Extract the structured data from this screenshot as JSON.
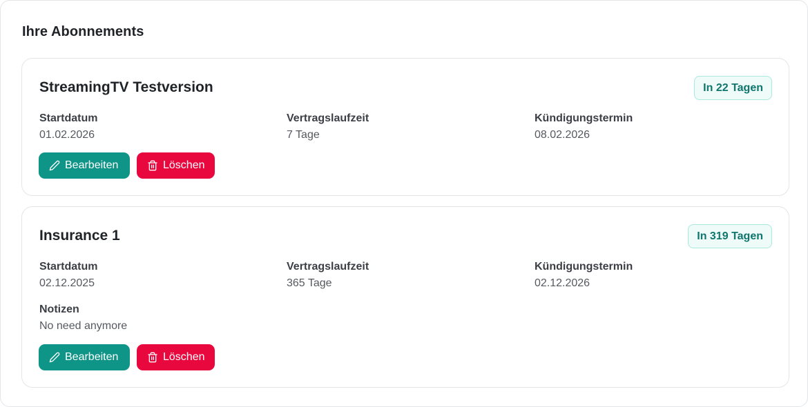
{
  "section": {
    "title": "Ihre Abonnements"
  },
  "subscriptions": [
    {
      "name": "StreamingTV Testversion",
      "badge": "In 22 Tagen",
      "fields": [
        {
          "label": "Startdatum",
          "value": "01.02.2026"
        },
        {
          "label": "Vertragslaufzeit",
          "value": "7 Tage"
        },
        {
          "label": "Kündigungstermin",
          "value": "08.02.2026"
        }
      ],
      "edit_label": "Bearbeiten",
      "delete_label": "Löschen"
    },
    {
      "name": "Insurance 1",
      "badge": "In 319 Tagen",
      "fields": [
        {
          "label": "Startdatum",
          "value": "02.12.2025"
        },
        {
          "label": "Vertragslaufzeit",
          "value": "365 Tage"
        },
        {
          "label": "Kündigungstermin",
          "value": "02.12.2026"
        }
      ],
      "notes": {
        "label": "Notizen",
        "value": "No need anymore"
      },
      "edit_label": "Bearbeiten",
      "delete_label": "Löschen"
    }
  ],
  "icons": {
    "edit": "pencil-icon",
    "delete": "trash-icon"
  },
  "colors": {
    "edit_button": "#0f9488",
    "delete_button": "#e8083e",
    "badge_text": "#0f766e",
    "badge_bg": "#eefbf8",
    "badge_border": "#a9e9dc"
  }
}
